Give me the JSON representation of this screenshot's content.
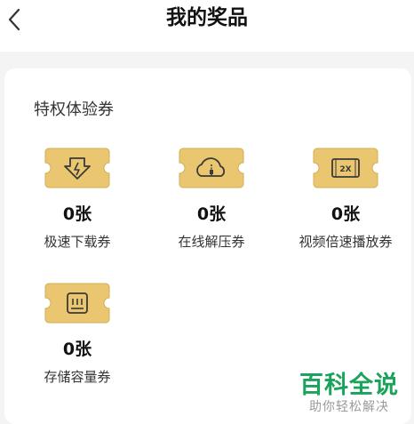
{
  "header": {
    "title": "我的奖品"
  },
  "section": {
    "title": "特权体验券"
  },
  "items": [
    {
      "count": "0张",
      "label": "极速下载券",
      "icon": "download-lightning-icon"
    },
    {
      "count": "0张",
      "label": "在线解压券",
      "icon": "cloud-zip-icon"
    },
    {
      "count": "0张",
      "label": "视频倍速播放券",
      "icon": "video-2x-icon"
    },
    {
      "count": "0张",
      "label": "存储容量券",
      "icon": "storage-icon"
    }
  ],
  "watermark": {
    "main": "百科全说",
    "sub": "助你轻松解决"
  },
  "colors": {
    "ticket": "#e9c66f",
    "ticket_dark": "#caa046",
    "watermark": "#1aa35a"
  }
}
